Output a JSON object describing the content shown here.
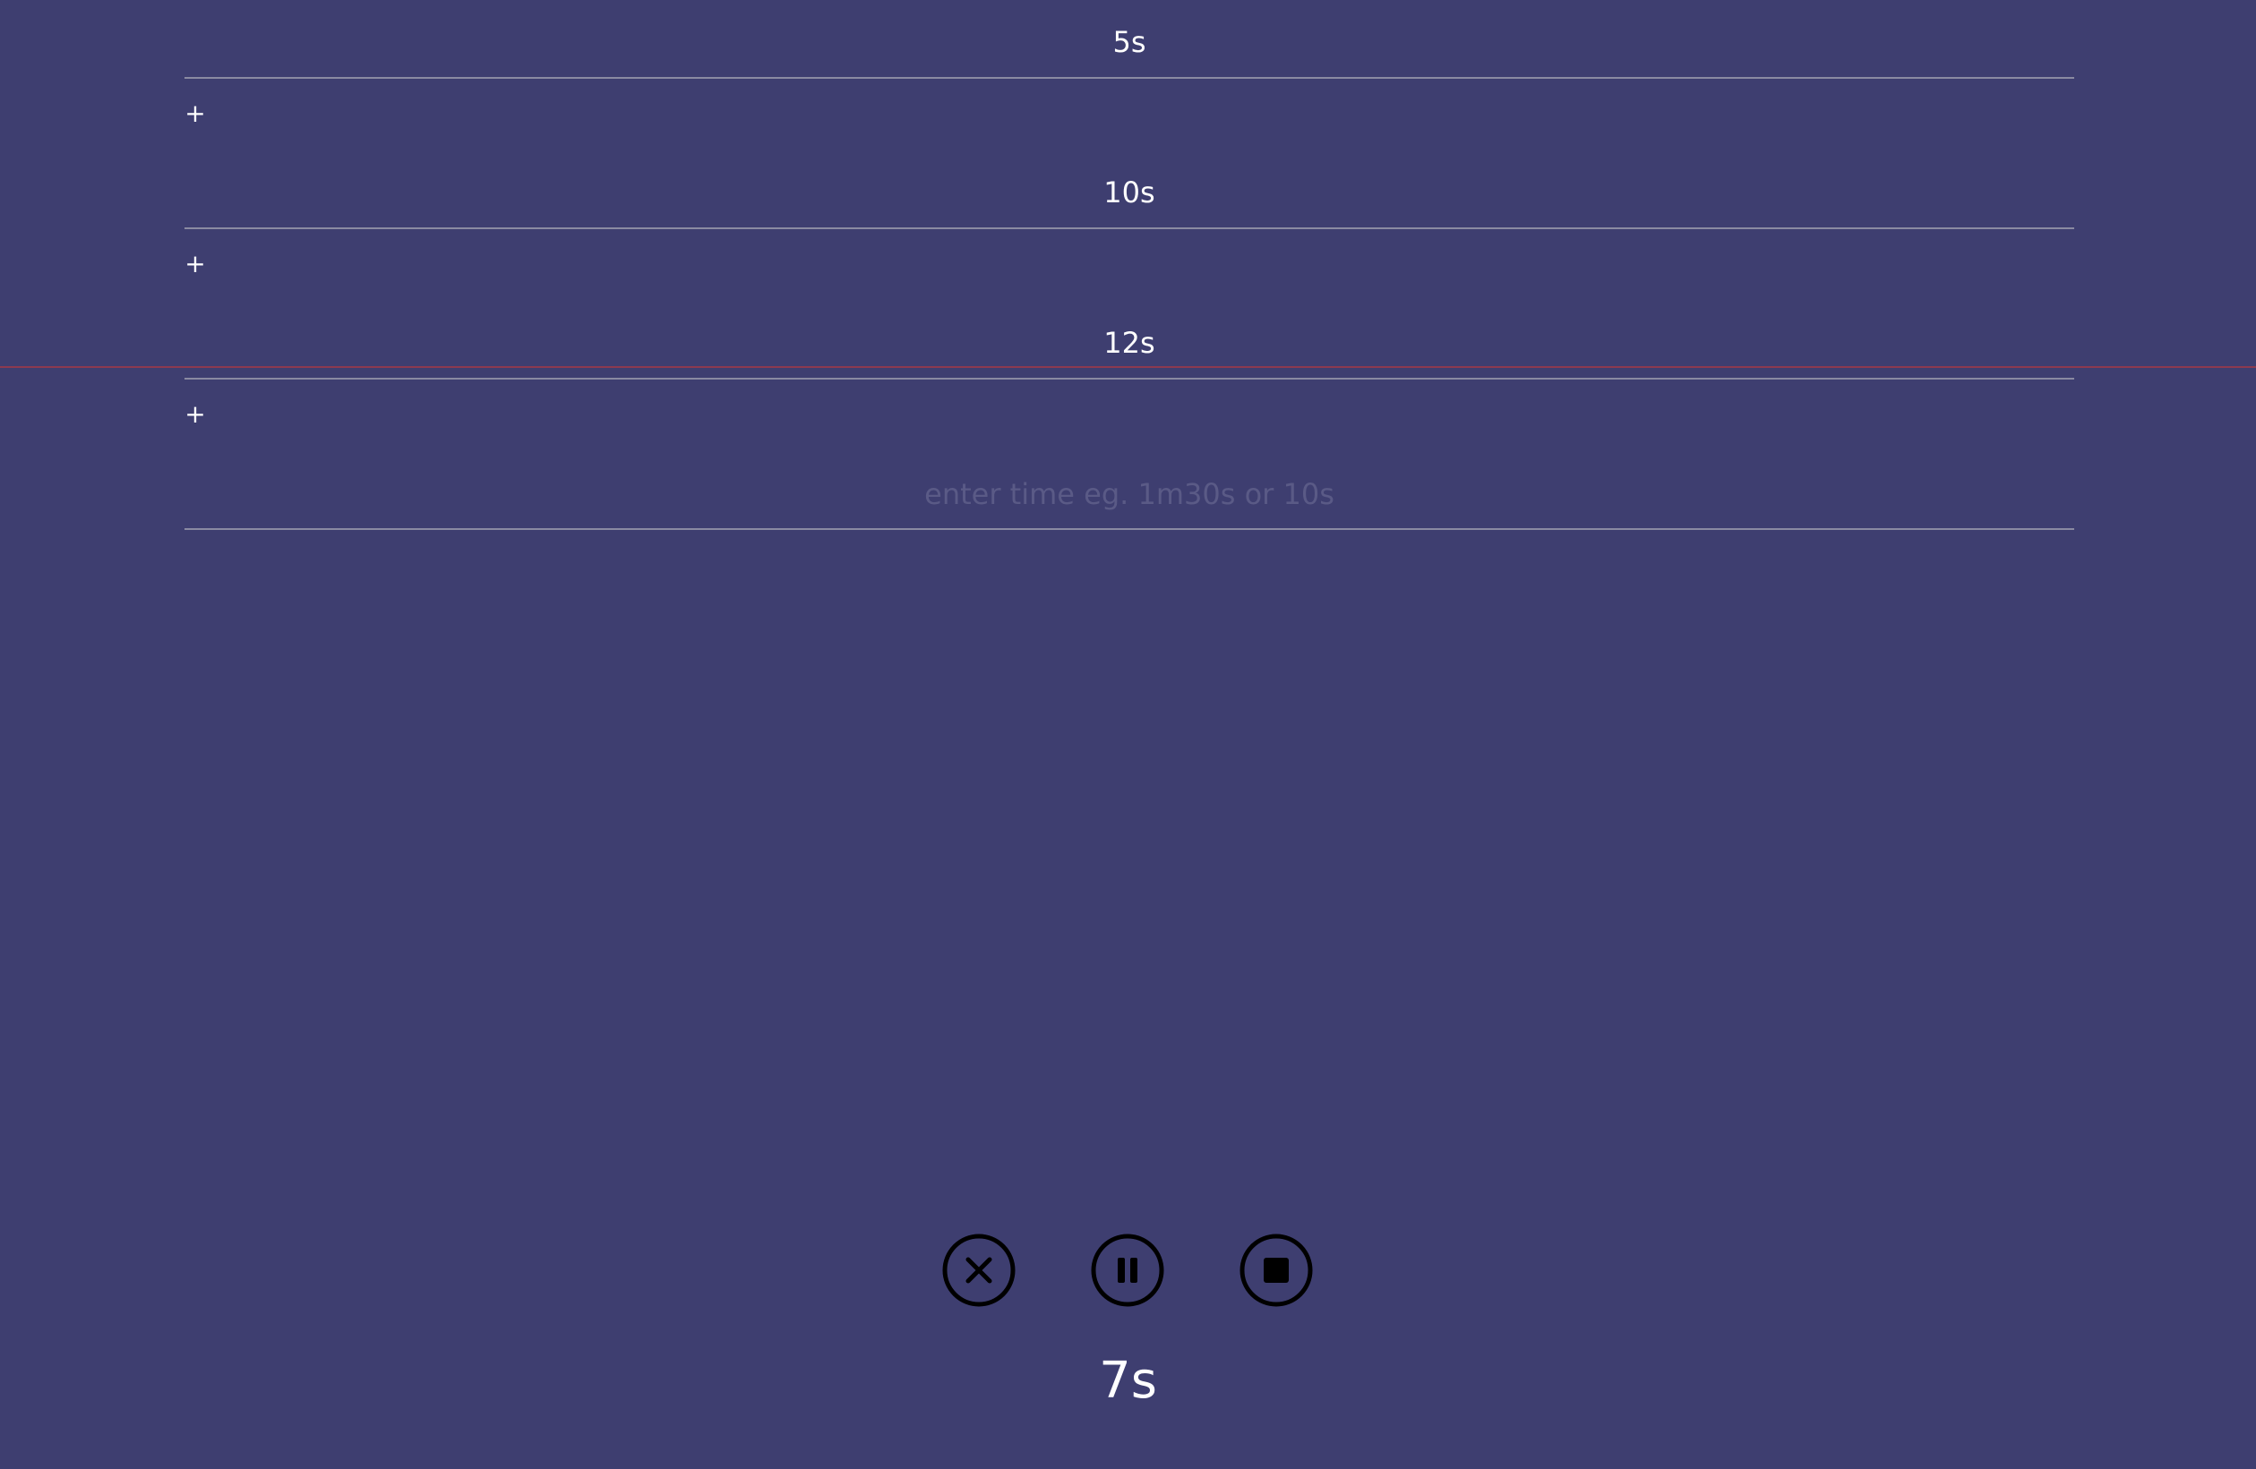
{
  "timers": [
    {
      "value": "5s",
      "add_label": "+"
    },
    {
      "value": "10s",
      "add_label": "+"
    },
    {
      "value": "12s",
      "add_label": "+"
    }
  ],
  "new_timer": {
    "value": "",
    "placeholder": "enter time eg. 1m30s or 10s"
  },
  "progress": {
    "color": "#8c3a50"
  },
  "controls": {
    "cancel_icon": "close-circle-icon",
    "pause_icon": "pause-circle-icon",
    "stop_icon": "stop-circle-icon"
  },
  "elapsed": "7s",
  "colors": {
    "background": "#3e3e70",
    "text": "#ffffff",
    "divider": "#8a8aa2",
    "icon": "#000000"
  }
}
